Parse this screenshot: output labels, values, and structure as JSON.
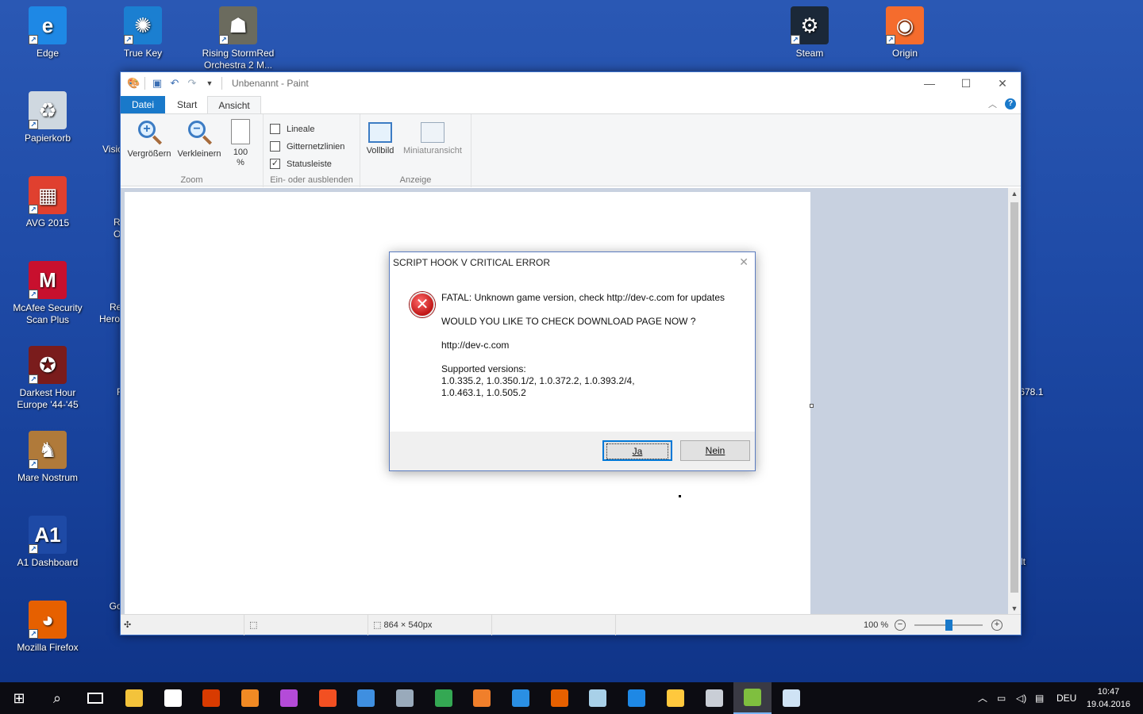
{
  "desktop": {
    "icons": [
      {
        "label": "Edge",
        "color": "#1e88e5",
        "glyph": "e"
      },
      {
        "label": "True Key",
        "color": "#1b7fd1",
        "glyph": "✺"
      },
      {
        "label": "Rising StormRed Orchestra 2 M...",
        "color": "#6b6b5e",
        "glyph": "☗"
      },
      {
        "label": "Steam",
        "color": "#1b2838",
        "glyph": "⚙"
      },
      {
        "label": "Origin",
        "color": "#f56c2d",
        "glyph": "◉"
      },
      {
        "label": "Papierkorb",
        "color": "#cfd8e0",
        "glyph": "♻"
      },
      {
        "label": "AVG 2015",
        "color": "#e0402f",
        "glyph": "▦"
      },
      {
        "label": "McAfee Security Scan Plus",
        "color": "#c8102e",
        "glyph": "M"
      },
      {
        "label": "Darkest Hour Europe '44-'45",
        "color": "#7a1c1c",
        "glyph": "✪"
      },
      {
        "label": "Mare Nostrum",
        "color": "#b07a3a",
        "glyph": "♞"
      },
      {
        "label": "A1 Dashboard",
        "color": "#1e4aa6",
        "glyph": "A1"
      },
      {
        "label": "Mozilla Firefox",
        "color": "#e66000",
        "glyph": "◕"
      },
      {
        "label": "Google Chrome",
        "color": "",
        "glyph": ""
      }
    ],
    "clipped_labels": [
      "Visic",
      "R",
      "O",
      "Re",
      "Hero",
      "F",
      ".678.1",
      "lt"
    ]
  },
  "paint": {
    "title": "Unbenannt - Paint",
    "tabs": [
      "Datei",
      "Start",
      "Ansicht"
    ],
    "ribbon": {
      "zoom": {
        "label": "Zoom",
        "zoom_in": "Vergrößern",
        "zoom_out": "Verkleinern",
        "hundred": "100",
        "hundred_unit": "%"
      },
      "show_hide": {
        "label": "Ein- oder ausblenden",
        "rulers": "Lineale",
        "gridlines": "Gitternetzlinien",
        "statusbar": "Statusleiste",
        "rulers_checked": false,
        "gridlines_checked": false,
        "statusbar_checked": true
      },
      "display": {
        "label": "Anzeige",
        "fullscreen": "Vollbild",
        "thumbnail": "Miniaturansicht"
      }
    },
    "status": {
      "size": "864 × 540px",
      "zoom": "100 %",
      "zoom_fraction": 0.5
    }
  },
  "dialog": {
    "title": "SCRIPT HOOK V CRITICAL ERROR",
    "line1": "FATAL: Unknown game version, check http://dev-c.com for updates",
    "line2": "WOULD YOU LIKE TO CHECK DOWNLOAD PAGE NOW ?",
    "line3": "http://dev-c.com",
    "line4": "Supported versions:",
    "line5": "1.0.335.2, 1.0.350.1/2, 1.0.372.2, 1.0.393.2/4,",
    "line6": "1.0.463.1, 1.0.505.2",
    "yes": "Ja",
    "no": "Nein"
  },
  "taskbar": {
    "apps": [
      {
        "name": "file-explorer",
        "color": "#f3c33b"
      },
      {
        "name": "store",
        "color": "#ffffff"
      },
      {
        "name": "office",
        "color": "#d83b01"
      },
      {
        "name": "app-orange",
        "color": "#f08a24"
      },
      {
        "name": "app-colorful",
        "color": "#b44bd8"
      },
      {
        "name": "windows-tiles",
        "color": "#f25022"
      },
      {
        "name": "app-blue-circle",
        "color": "#3f8fe0"
      },
      {
        "name": "app-gray-circle",
        "color": "#9ab"
      },
      {
        "name": "chrome",
        "color": "#34a853"
      },
      {
        "name": "media-player",
        "color": "#f07f2b"
      },
      {
        "name": "internet-explorer",
        "color": "#2a8fe3"
      },
      {
        "name": "firefox",
        "color": "#e66000"
      },
      {
        "name": "app-paper",
        "color": "#a8d0e8"
      },
      {
        "name": "edge",
        "color": "#1e88e5"
      },
      {
        "name": "app-yellow",
        "color": "#ffc83d"
      },
      {
        "name": "app-gray",
        "color": "#c9ced6"
      },
      {
        "name": "gta-v",
        "color": "#7fbf3f"
      },
      {
        "name": "paint",
        "color": "#cfe3f5"
      }
    ],
    "language": "DEU",
    "time": "10:47",
    "date": "19.04.2016"
  }
}
